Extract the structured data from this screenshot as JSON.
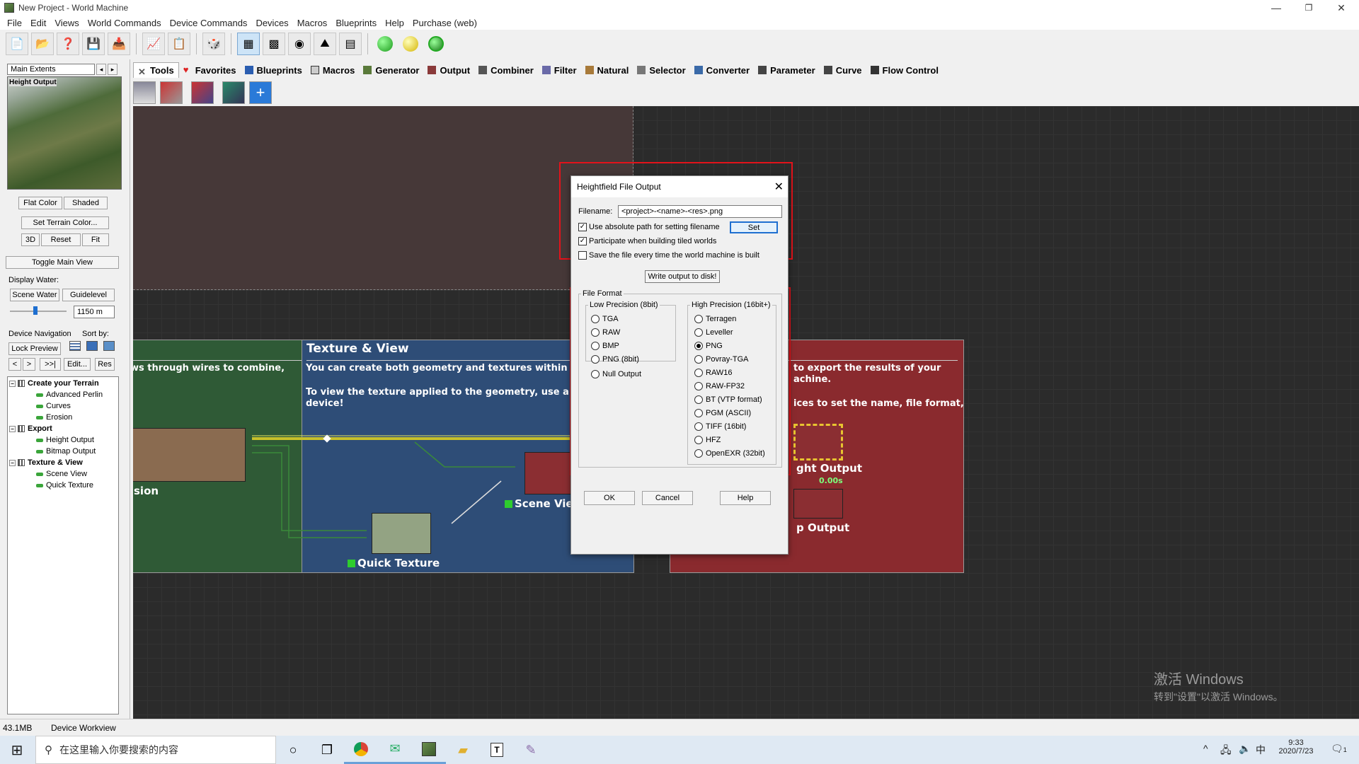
{
  "window": {
    "title": "New Project - World Machine",
    "minimize": "—",
    "restore": "❐",
    "close": "✕"
  },
  "menu": [
    "File",
    "Edit",
    "Views",
    "World Commands",
    "Device Commands",
    "Devices",
    "Macros",
    "Blueprints",
    "Help",
    "Purchase (web)"
  ],
  "left_panel": {
    "view_select": "Main Extents",
    "preview_label": "Height Output",
    "flat_color": "Flat Color",
    "shaded": "Shaded",
    "set_terrain_color": "Set Terrain Color...",
    "btn_3d": "3D",
    "btn_reset": "Reset",
    "btn_fit": "Fit",
    "toggle_main_view": "Toggle Main View",
    "display_water": "Display Water:",
    "scene_water": "Scene Water",
    "guidelevel": "Guidelevel",
    "water_value": "1150 m",
    "device_navigation": "Device Navigation",
    "sort_by": "Sort by:",
    "lock_preview": "Lock Preview",
    "nav_back": "<",
    "nav_fwd": ">",
    "nav_end": ">>|",
    "edit": "Edit...",
    "res": "Res",
    "tree": [
      {
        "label": "Create your Terrain",
        "type": "group"
      },
      {
        "label": "Advanced Perlin",
        "type": "leaf"
      },
      {
        "label": "Curves",
        "type": "leaf"
      },
      {
        "label": "Erosion",
        "type": "leaf"
      },
      {
        "label": "Export",
        "type": "group"
      },
      {
        "label": "Height Output",
        "type": "leaf"
      },
      {
        "label": "Bitmap Output",
        "type": "leaf"
      },
      {
        "label": "Texture & View",
        "type": "group"
      },
      {
        "label": "Scene View",
        "type": "leaf"
      },
      {
        "label": "Quick Texture",
        "type": "leaf"
      }
    ]
  },
  "tabs": [
    "Tools",
    "Favorites",
    "Blueprints",
    "Macros",
    "Generator",
    "Output",
    "Combiner",
    "Filter",
    "Natural",
    "Selector",
    "Converter",
    "Parameter",
    "Curve",
    "Flow Control"
  ],
  "canvas": {
    "group_left_text": "ws through wires to combine,",
    "group_left_node": "sion",
    "texture_view_title": "Texture & View",
    "texture_view_text1": "You can create both geometry and textures within Wo",
    "texture_view_text2": "To view the texture applied to the geometry, use a Sce",
    "texture_view_text3": "device!",
    "scene_view": "Scene Vie",
    "quick_texture": "Quick Texture",
    "export_text1": "to export the results of your",
    "export_text2": "achine.",
    "export_text3": "ices to set the name, file format,",
    "height_output": "ght Output",
    "height_time": "0.00s",
    "bitmap_output": "p Output"
  },
  "dialog": {
    "title": "Heightfield File Output",
    "filename_label": "Filename:",
    "filename_value": "<project>-<name>-<res>.png",
    "use_absolute": "Use absolute path for setting filename",
    "set": "Set",
    "participate": "Participate when building tiled worlds",
    "save_every": "Save the file every time the world machine is built",
    "write_output": "Write output to disk!",
    "file_format": "File Format",
    "low_precision": "Low Precision (8bit)",
    "high_precision": "High Precision (16bit+)",
    "low_options": [
      "TGA",
      "RAW",
      "BMP",
      "PNG (8bit)"
    ],
    "null_output": "Null Output",
    "high_options": [
      "Terragen",
      "Leveller",
      "PNG",
      "Povray-TGA",
      "RAW16",
      "RAW-FP32",
      "BT (VTP format)",
      "PGM (ASCII)",
      "TIFF (16bit)",
      "HFZ",
      "OpenEXR (32bit)"
    ],
    "selected_high": "PNG",
    "ok": "OK",
    "cancel": "Cancel",
    "help": "Help"
  },
  "status": {
    "memory": "43.1MB",
    "mode": "Device Workview"
  },
  "taskbar": {
    "search_placeholder": "在这里输入你要搜索的内容",
    "time": "9:33",
    "date": "2020/7/23",
    "ime": "中",
    "notif": "1"
  },
  "watermark": {
    "line1": "激活 Windows",
    "line2": "转到\"设置\"以激活 Windows。"
  },
  "colors": {
    "accent_red": "#e3121a",
    "green_group": "#2f5a36",
    "blue_group": "#2e4d77",
    "red_group": "#8a2a2e"
  }
}
